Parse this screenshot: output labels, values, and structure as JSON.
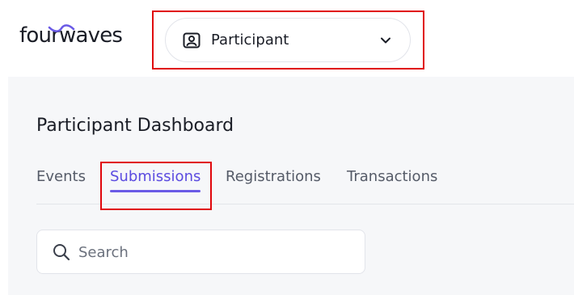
{
  "brand": {
    "logo_text": "fourwaves",
    "accent": "#6a5ae6"
  },
  "role_selector": {
    "label": "Participant",
    "icon": "user-badge-icon",
    "chevron": "chevron-down-icon"
  },
  "dashboard": {
    "title": "Participant Dashboard",
    "tabs": [
      {
        "label": "Events",
        "active": false
      },
      {
        "label": "Submissions",
        "active": true
      },
      {
        "label": "Registrations",
        "active": false
      },
      {
        "label": "Transactions",
        "active": false
      }
    ],
    "active_tab_color": "#5b4be0"
  },
  "search": {
    "placeholder": "Search",
    "value": "",
    "icon": "search-icon"
  },
  "highlight": {
    "color": "#e0060b"
  }
}
